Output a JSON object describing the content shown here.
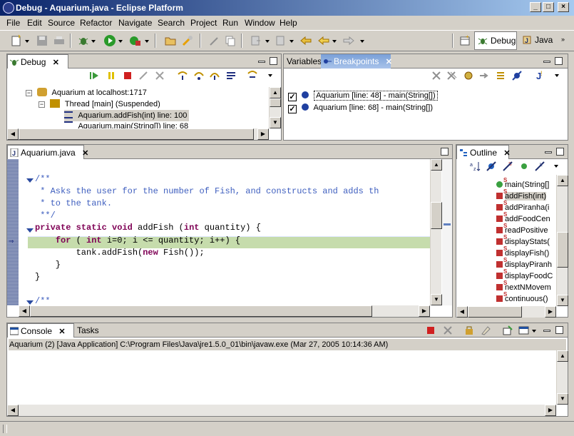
{
  "window": {
    "title": "Debug - Aquarium.java - Eclipse Platform"
  },
  "menu": [
    "File",
    "Edit",
    "Source",
    "Refactor",
    "Navigate",
    "Search",
    "Project",
    "Run",
    "Window",
    "Help"
  ],
  "perspectives": {
    "debug": "Debug",
    "java": "Java"
  },
  "debug_view": {
    "tab": "Debug",
    "tree": [
      "Aquarium at localhost:1717",
      "Thread [main] (Suspended)",
      "Aquarium.addFish(int) line: 100",
      "Aquarium.main(String[]) line: 68"
    ]
  },
  "breakpoints_view": {
    "tabs": [
      "Variables",
      "Breakpoints"
    ],
    "items": [
      "Aquarium [line: 48] - main(String[])",
      "Aquarium [line: 68] - main(String[])"
    ]
  },
  "editor": {
    "tab": "Aquarium.java",
    "lines": [
      {
        "parts": [
          [
            "cmt",
            "/**"
          ]
        ]
      },
      {
        "parts": [
          [
            "cmt",
            " * Asks the user for the number of Fish, and constructs and adds th"
          ]
        ]
      },
      {
        "parts": [
          [
            "cmt",
            " * to the tank."
          ]
        ]
      },
      {
        "parts": [
          [
            "cmt",
            " **/"
          ]
        ]
      },
      {
        "parts": [
          [
            "kw",
            "private"
          ],
          [
            "",
            " "
          ],
          [
            "kw",
            "static"
          ],
          [
            "",
            " "
          ],
          [
            "kw",
            "void"
          ],
          [
            "",
            " addFish ("
          ],
          [
            "kw",
            "int"
          ],
          [
            "",
            " quantity) {"
          ]
        ]
      },
      {
        "parts": [
          [
            "",
            "    "
          ],
          [
            "kw",
            "for"
          ],
          [
            "",
            " ( "
          ],
          [
            "kw",
            "int"
          ],
          [
            "",
            " i=0; i <= quantity; i++) {"
          ]
        ]
      },
      {
        "parts": [
          [
            "",
            "        tank.addFish("
          ],
          [
            "kw",
            "new"
          ],
          [
            "",
            " Fish());"
          ]
        ]
      },
      {
        "parts": [
          [
            "",
            "    }"
          ]
        ]
      },
      {
        "parts": [
          [
            "",
            "}"
          ]
        ]
      },
      {
        "parts": [
          [
            "",
            ""
          ]
        ]
      },
      {
        "parts": [
          [
            "cmt",
            "/**"
          ]
        ]
      }
    ]
  },
  "outline": {
    "tab": "Outline",
    "items": [
      "main(String[]",
      "addFish(int)",
      "addPiranha(i",
      "addFoodCen",
      "readPositive",
      "displayStats(",
      "displayFish()",
      "displayPiranh",
      "displayFoodC",
      "nextNMovem",
      "continuous()"
    ]
  },
  "console": {
    "tabs": [
      "Console",
      "Tasks"
    ],
    "process": "Aquarium (2) [Java Application] C:\\Program Files\\Java\\jre1.5.0_01\\bin\\javaw.exe (Mar 27, 2005 10:14:36 AM)"
  }
}
